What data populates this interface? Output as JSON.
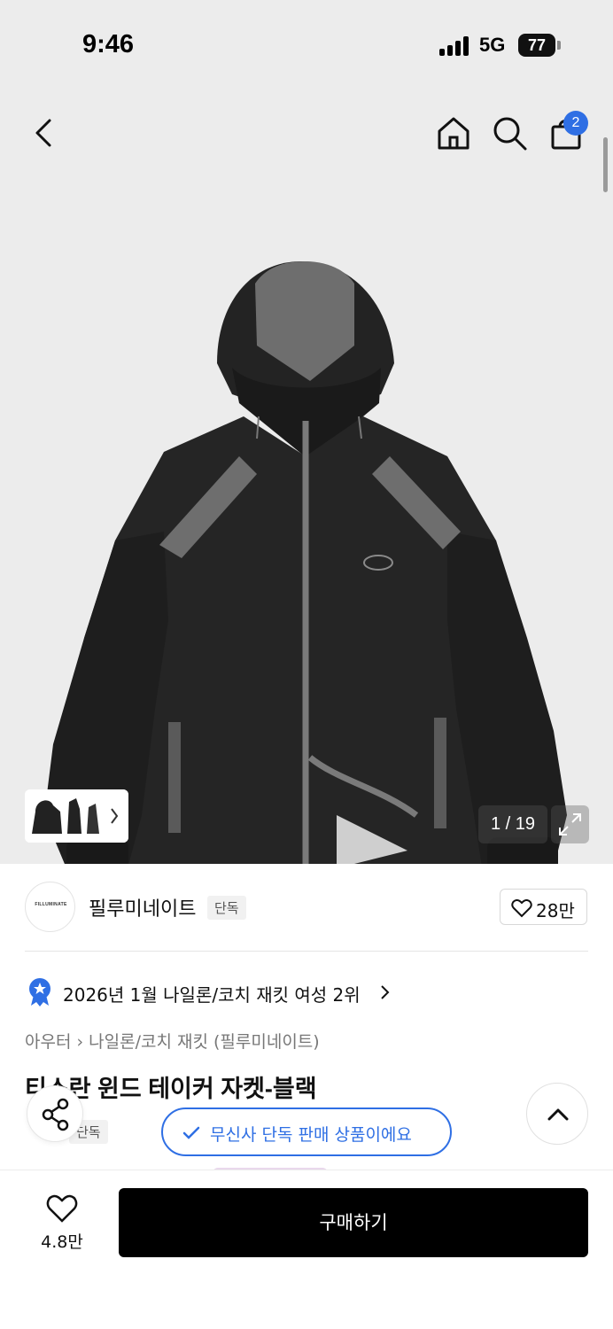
{
  "status_bar": {
    "time": "9:46",
    "network": "5G",
    "battery": "77"
  },
  "header": {
    "cart_count": "2",
    "icons": [
      "chevron-left-icon",
      "home-icon",
      "search-icon",
      "shopping-bag-icon"
    ]
  },
  "gallery": {
    "counter": "1 / 19",
    "current_index": 1,
    "total": 19
  },
  "brand": {
    "name": "필루미네이트",
    "logo_text": "FILLUMINATE",
    "tag": "단독",
    "likes": "28만"
  },
  "ranking": {
    "text": "2026년 1월 나일론/코치 재킷 여성 2위"
  },
  "breadcrumb": {
    "category": "아우터",
    "subcategory": "나일론/코치 재킷 (필루미네이트)"
  },
  "product": {
    "title": "티스란 윈드 테이커 자켓-블랙",
    "tag": "단독"
  },
  "exclusive_notice": {
    "text": "무신사 단독 판매 상품이에요"
  },
  "bottom_bar": {
    "wishlist_count": "4.8만",
    "buy_label": "구매하기"
  },
  "colors": {
    "accent_blue": "#2f6fe4",
    "buy_button": "#000000",
    "hero_background": "#ececec"
  }
}
